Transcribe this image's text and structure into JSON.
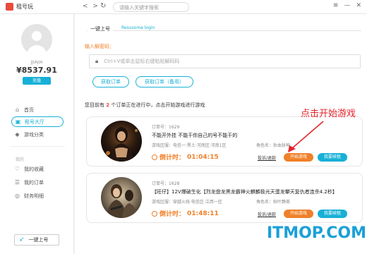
{
  "app": {
    "title": "租号玩",
    "logo_icon": "app-logo-icon"
  },
  "toolbar": {
    "back": "<",
    "forward": ">",
    "refresh": "C",
    "search_placeholder": "请输入关键字搜索",
    "controls": [
      "≡",
      "—",
      "✕"
    ]
  },
  "sidebar": {
    "username": "JJIAJIA",
    "balance": "¥8537.91",
    "recharge_label": "充值",
    "items": [
      {
        "label": "首页",
        "icon": "home-icon",
        "glyph": "⌂"
      },
      {
        "label": "租号大厅",
        "icon": "hall-icon",
        "glyph": "▣",
        "active": true
      },
      {
        "label": "游戏分类",
        "icon": "category-icon",
        "glyph": "◆"
      }
    ],
    "group_label": "我的",
    "my_items": [
      {
        "label": "我的收藏",
        "icon": "favorites-icon",
        "glyph": "♡"
      },
      {
        "label": "我的订单",
        "icon": "orders-icon",
        "glyph": "☰"
      },
      {
        "label": "财务明细",
        "icon": "finance-icon",
        "glyph": "◎"
      }
    ],
    "onekey_label": "一键上号"
  },
  "main": {
    "tab_label": "一键上号",
    "faq_link": "Resusoma login",
    "password_label": "输入解密码：",
    "password_placeholder": "Ctrl+V或单击鼠标右键粘贴解码码",
    "get_order_label": "获取订单",
    "get_order_backup_label": "获取订单（备用）",
    "orders_prefix": "您目前有",
    "orders_count": "2",
    "orders_suffix": "个订单正在进行中，点击开始游戏进行游戏",
    "annotation": "点击开始游戏"
  },
  "orders": [
    {
      "order_no": "订单号：1629",
      "title": "不能开外挂 不能干你自己的号不能干的",
      "area": "游戏区服：电信一·黑土·河南区·河南1区",
      "role": "角色名：狄血豺神",
      "timer_label": "倒计时：",
      "timer_value": "01:04:15",
      "complain": "投诉/退款",
      "start": "开始游戏",
      "renew": "我要续租"
    },
    {
      "order_no": "订单号：1628",
      "title": "【旺仔】12V爆破生化【烈龙盘龙黑龙霸神火麒麟极光天蛋龙攀天复仇者连杀4.2秒】",
      "area": "游戏区服：穿越火线·电信区·江西一区",
      "role": "角色名：秋叶静美",
      "timer_label": "倒计时：",
      "timer_value": "01:48:11",
      "complain": "投诉/退款",
      "start": "开始游戏",
      "renew": "我要续租"
    }
  ],
  "watermark": "ITMOP.COM",
  "colors": {
    "accent": "#18b0d6",
    "orange": "#f08028",
    "red": "#e5232b",
    "watermark": "#1aa0d8"
  }
}
